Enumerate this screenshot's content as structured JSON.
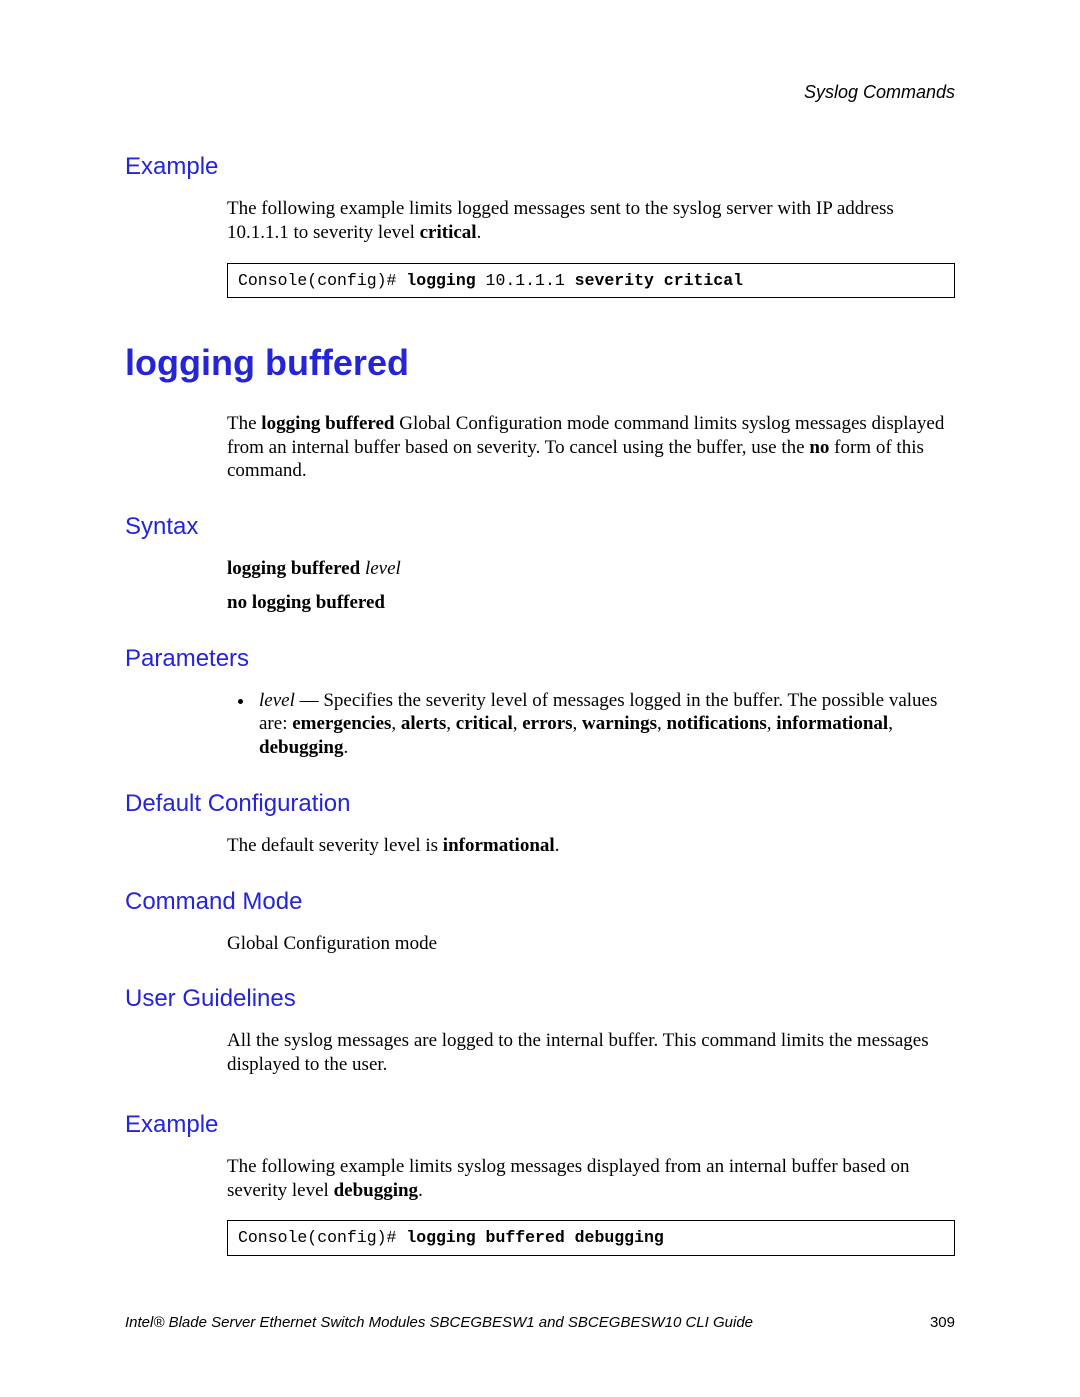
{
  "header": {
    "section": "Syslog Commands"
  },
  "example1": {
    "heading": "Example",
    "para_pre": "The following example limits logged messages sent to the syslog server with IP address 10.1.1.1 to severity level ",
    "para_bold": "critical",
    "para_post": ".",
    "code_prompt": "Console(config)# ",
    "code_b1": "logging ",
    "code_ip": "10.1.1.1 ",
    "code_b2": "severity critical"
  },
  "command": {
    "title": "logging buffered",
    "intro_pre": "The ",
    "intro_b1": "logging buffered",
    "intro_mid": " Global Configuration mode command limits syslog messages displayed from an internal buffer based on severity. To cancel using the buffer, use the ",
    "intro_b2": "no",
    "intro_post": " form of this command."
  },
  "syntax": {
    "heading": "Syntax",
    "line1_b": "logging buffered ",
    "line1_i": "level",
    "line2_b": "no logging buffered"
  },
  "parameters": {
    "heading": "Parameters",
    "item_i": "level",
    "item_mid": " — Specifies the severity level of messages logged in the buffer. The possible values are: ",
    "v1": "emergencies",
    "v2": "alerts",
    "v3": "critical",
    "v4": "errors",
    "v5": "warnings",
    "v6": "notifications",
    "v7": "informational",
    "v8": "debugging",
    "sep": ", ",
    "end": "."
  },
  "defaultcfg": {
    "heading": "Default Configuration",
    "text_pre": "The default severity level is ",
    "text_b": "informational",
    "text_post": "."
  },
  "cmdmode": {
    "heading": "Command Mode",
    "text": "Global Configuration mode"
  },
  "guidelines": {
    "heading": "User Guidelines",
    "text": "All the syslog messages are logged to the internal buffer. This command limits the messages displayed to the user."
  },
  "example2": {
    "heading": "Example",
    "para_pre": "The following example limits syslog messages displayed from an internal buffer based on severity level ",
    "para_b": "debugging",
    "para_post": ".",
    "code_prompt": "Console(config)# ",
    "code_b": "logging buffered debugging"
  },
  "footer": {
    "title": "Intel® Blade Server Ethernet Switch Modules SBCEGBESW1 and SBCEGBESW10 CLI Guide",
    "page": "309"
  }
}
